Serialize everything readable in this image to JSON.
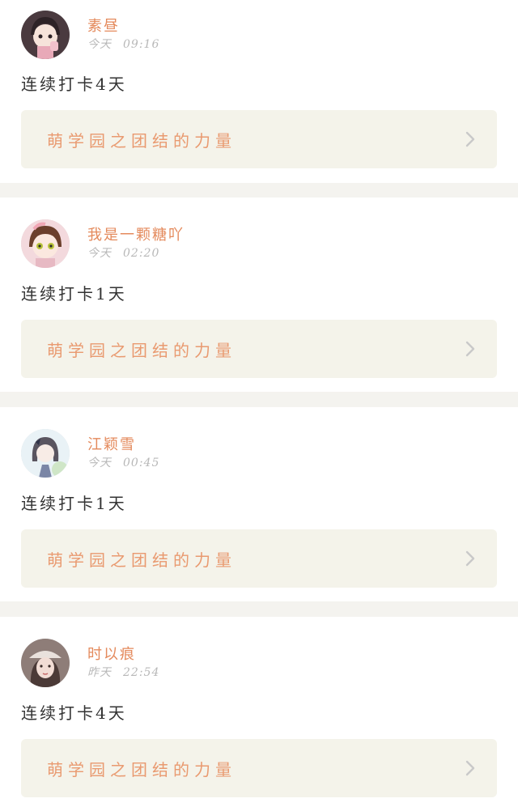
{
  "posts": [
    {
      "username": "素昼",
      "day": "今天",
      "time": "09:16",
      "streak": "连续打卡4天",
      "topic": "萌学园之团结的力量",
      "avatar_icon": "avatar-girl-pink-hat-icon"
    },
    {
      "username": "我是一颗糖吖",
      "day": "今天",
      "time": "02:20",
      "streak": "连续打卡1天",
      "topic": "萌学园之团结的力量",
      "avatar_icon": "avatar-girl-anime-icon"
    },
    {
      "username": "江颖雪",
      "day": "今天",
      "time": "00:45",
      "streak": "连续打卡1天",
      "topic": "萌学园之团结的力量",
      "avatar_icon": "avatar-girl-bow-icon"
    },
    {
      "username": "时以痕",
      "day": "昨天",
      "time": "22:54",
      "streak": "连续打卡4天",
      "topic": "萌学园之团结的力量",
      "avatar_icon": "avatar-girl-beret-icon"
    }
  ],
  "colors": {
    "username": "#e48a5c",
    "topic_text": "#e99a70",
    "topic_bg": "#f4f3ea",
    "time": "#b8b8b8",
    "separator": "#f4f3ef"
  }
}
